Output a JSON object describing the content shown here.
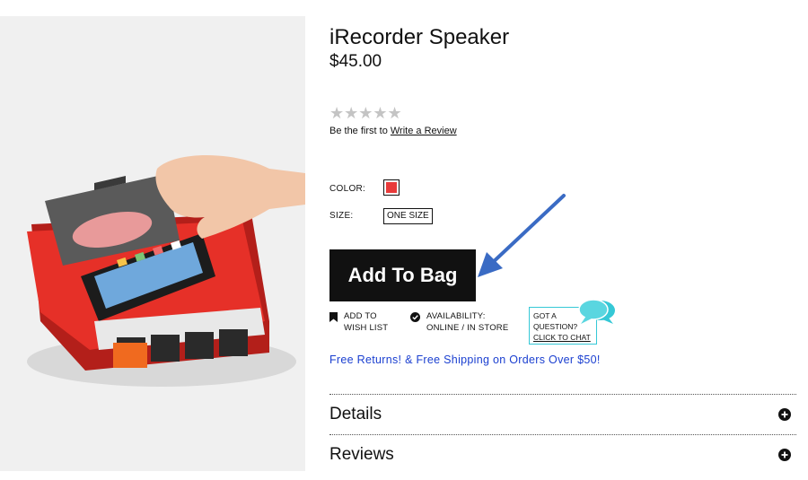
{
  "product": {
    "title": "iRecorder Speaker",
    "price": "$45.00",
    "rating": {
      "stars_display": "★★★★★",
      "filled": 0,
      "max": 5,
      "prefix": "Be the first to",
      "link_label": "Write a Review"
    },
    "options": {
      "color_label": "COLOR:",
      "color_swatch": "#e83a3a",
      "size_label": "SIZE:",
      "size_value": "ONE SIZE"
    },
    "add_to_bag_label": "Add To Bag",
    "wishlist": {
      "line1": "ADD TO",
      "line2": "WISH LIST",
      "icon": "bookmark-icon"
    },
    "availability": {
      "line1": "AVAILABILITY:",
      "line2": "ONLINE / IN STORE",
      "icon": "check-circle-icon"
    },
    "chat": {
      "line1": "GOT A",
      "line2": "QUESTION?",
      "line3": "CLICK TO CHAT",
      "icon": "chat-bubbles-icon",
      "accent": "#35c8d6"
    },
    "promo": "Free Returns! & Free Shipping on Orders Over $50!",
    "promo_color": "#1a3fd0",
    "sections": [
      {
        "label": "Details",
        "icon": "plus-circle-icon"
      },
      {
        "label": "Reviews",
        "icon": "plus-circle-icon"
      }
    ]
  },
  "annotation": {
    "arrow_color": "#3a6bc4",
    "icon": "arrow-icon"
  },
  "image": {
    "device_color": "#e63028",
    "button_color": "#f06a1f"
  }
}
